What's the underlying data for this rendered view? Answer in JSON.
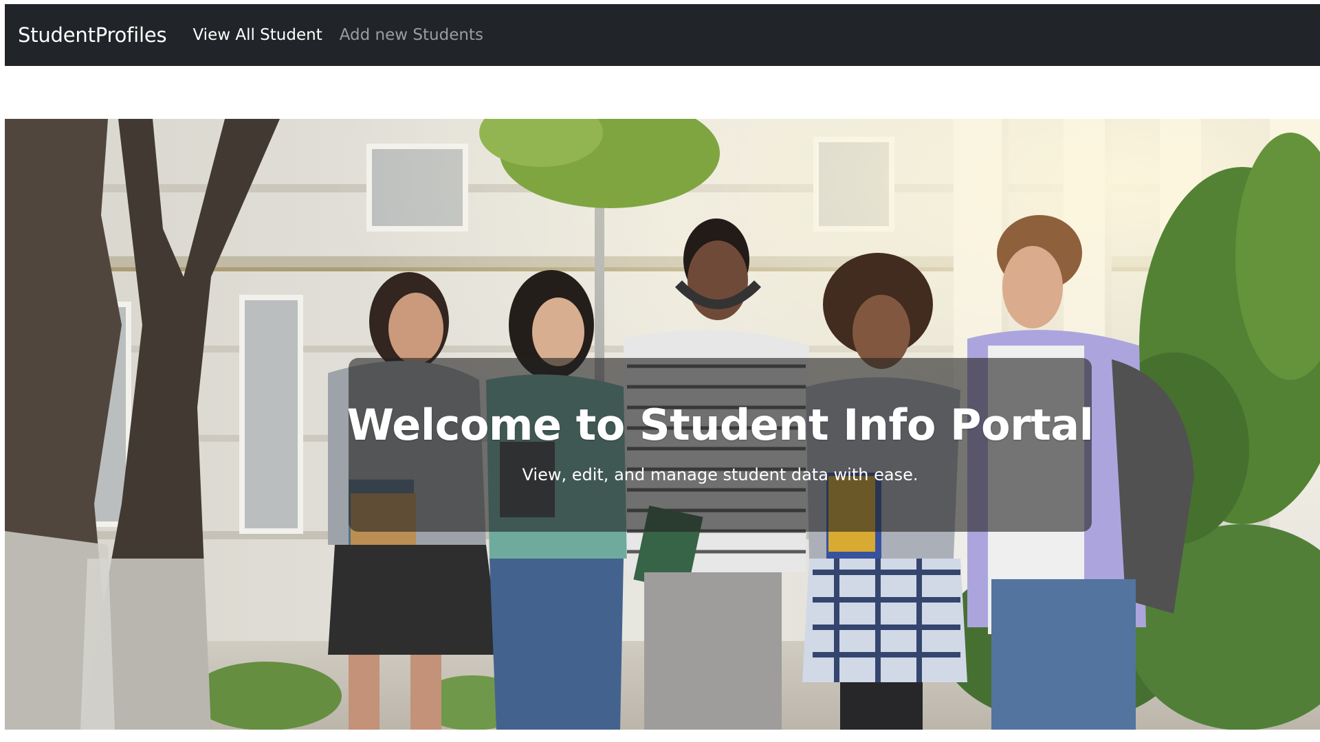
{
  "navbar": {
    "brand": "StudentProfiles",
    "links": [
      {
        "label": "View All Student",
        "active": true
      },
      {
        "label": "Add new Students",
        "active": false
      }
    ],
    "background": "#212529"
  },
  "hero": {
    "title": "Welcome to Student Info Portal",
    "subtitle": "View, edit, and manage student data with ease.",
    "image": "group of five smiling students walking with books outside a campus building"
  }
}
